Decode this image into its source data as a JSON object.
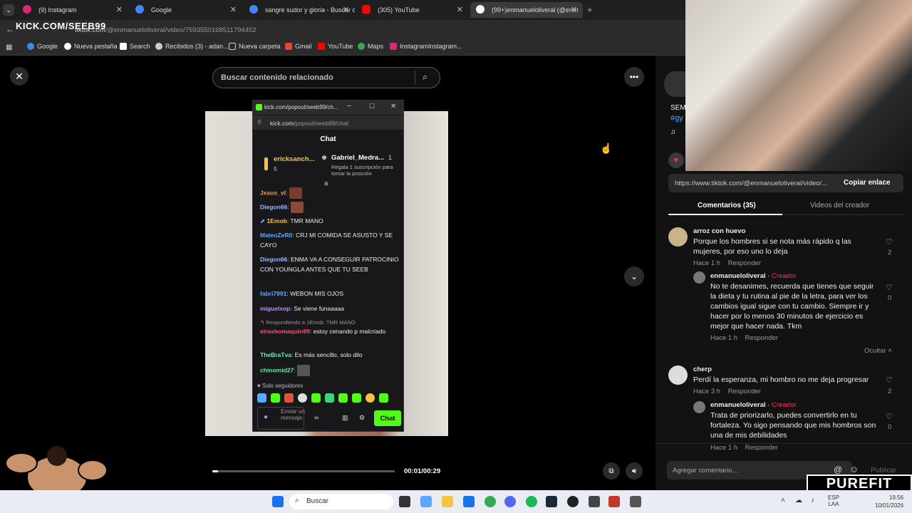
{
  "browser": {
    "tabs": [
      {
        "label": "(9) Instagram",
        "color": "#d62976"
      },
      {
        "label": "Google",
        "color": "#4285f4"
      },
      {
        "label": "sangre sudor y gloria - Buscar c",
        "color": "#4285f4"
      },
      {
        "label": "(305) YouTube",
        "color": "#ff0000"
      },
      {
        "label": "(99+)enmanueloliveral (@enm",
        "color": "#111111"
      }
    ],
    "url_host": "tiktok.com",
    "url_path": "/@enmanueloliveral/video/7593550168511794452",
    "overlay_brand": "KICK.COM/SEEB99",
    "bookmarks": [
      "Google",
      "Nueva pestaña",
      "Search",
      "Recibidos (3) - adan...",
      "Nueva carpeta",
      "Gmail",
      "YouTube",
      "Maps",
      "InstagramInstagram..."
    ]
  },
  "player": {
    "search_placeholder": "Buscar contenido relacionado",
    "time": "00:01/00:29",
    "progress": 0.03
  },
  "popout": {
    "title": "kick.com/popout/seeb99/ch...",
    "url_host": "kick.com",
    "url_path": "/popout/seeb99/chat",
    "header": "Chat",
    "top1_name": "ericksanch...",
    "top1_count": "5",
    "top2_name": "Gabriel_Medra...",
    "top2_count": "1",
    "top2_sub": "Regala 1 suscripción para tomar la posición",
    "messages": [
      {
        "user": "Jxsus_vl",
        "color": "#f59e42",
        "text": ""
      },
      {
        "user": "Diegon66",
        "color": "#9bb8ff",
        "text": ""
      },
      {
        "user": "1Emob",
        "color": "#f5c542",
        "text": "TMR MANO"
      },
      {
        "user": "MateoZeR0",
        "color": "#5aa8ff",
        "text": "CRJ MI COMIDA SE ASUSTO Y SE CAYO"
      },
      {
        "user": "Diegon66",
        "color": "#9bb8ff",
        "text": "ENMA VA A CONSEGUIR PATROCINIO CON YOUNGLA ANTES QUE TU SEEB"
      },
      {
        "user": "fabri7991",
        "color": "#5aa8ff",
        "text": "WEBON MIS OJOS"
      },
      {
        "user": "miguelxop",
        "color": "#c08cff",
        "text": "Se viene funaaaaa"
      },
      {
        "user": "elrashomaquin99",
        "color": "#ff4d6d",
        "text": "estoy cenando p malcriado"
      },
      {
        "user": "TheBraTva",
        "color": "#5ef0c0",
        "text": "Es más sencillo, solo dilo"
      },
      {
        "user": "chinomid27",
        "color": "#5ef0a0",
        "text": ""
      }
    ],
    "reply_note": "Respondiendo a 1Emob: TMR MANO",
    "followers_only": "Solo seguidores",
    "input_placeholder": "Enviar un mensaje",
    "send_label": "Chat"
  },
  "sidebar": {
    "video_caption": "SEM",
    "video_tag": "#gy",
    "share_url": "https://www.tiktok.com/@enmanueloliveral/video/...",
    "copy_label": "Copiar enlace",
    "tab_comments": "Comentarios (35)",
    "tab_creator": "Videos del creador",
    "comments": [
      {
        "user": "arroz con huevo",
        "text": "Porque los hombres si se nota más rápido q las mujeres, por eso uno lo deja",
        "time": "Hace 1 h",
        "reply": "Responder",
        "likes": "2"
      },
      {
        "user": "enmanueloliveral",
        "badge": "Creador",
        "text": "No te desanimes, recuerda que tienes que seguir la dieta y tu rutina al pie de la letra, para ver los cambios igual sigue con tu cambio. Siempre ir y hacer por lo menos 30 minutos de ejercicio es mejor que hacer nada. Tkm",
        "time": "Hace 1 h",
        "reply": "Responder",
        "likes": "0"
      },
      {
        "user": "cherp",
        "text": "Perdí la esperanza, mi hombro no me deja progresar",
        "time": "Hace 3 h",
        "reply": "Responder",
        "likes": "2"
      },
      {
        "user": "enmanueloliveral",
        "badge": "Creador",
        "text": "Trata de priorizarlo, puedes convertirlo en tu fortaleza. Yo sigo pensando que mis hombros son una de mis debilidades",
        "time": "Hace 1 h",
        "reply": "Responder",
        "likes": "0"
      }
    ],
    "hide_label": "Ocultar",
    "add_comment": "Agregar comentario...",
    "publish": "Publicar"
  },
  "overlay": {
    "brand": "PUREFIT"
  },
  "taskbar": {
    "search": "Buscar",
    "lang": "ESP",
    "lang2": "LAA",
    "clock": "19:56",
    "date": "10/01/2026"
  }
}
